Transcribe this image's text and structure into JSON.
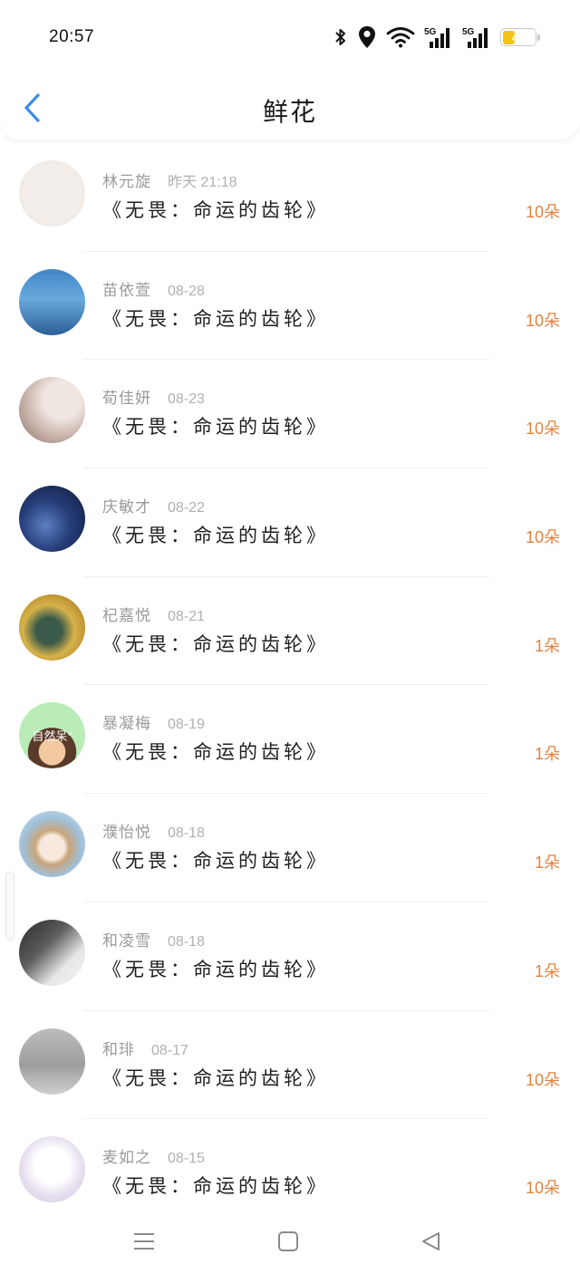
{
  "status_bar": {
    "time": "20:57",
    "battery_level": 43,
    "battery_label": "43",
    "icons": [
      "bluetooth-icon",
      "location-icon",
      "wifi-icon",
      "signal-5g-icon",
      "signal-5g-icon",
      "battery-icon"
    ],
    "network_label_1": "5G",
    "network_label_2": "5G"
  },
  "header": {
    "title": "鲜花",
    "back_icon": "chevron-left-icon",
    "accent_color": "#3a8ee6"
  },
  "colors": {
    "count_color": "#e3833f",
    "name_color": "#9a9a9a"
  },
  "items": [
    {
      "name": "林元旋",
      "time": "昨天 21:18",
      "book": "《无畏：命运的齿轮》",
      "count": "10朵",
      "avatar_label": ""
    },
    {
      "name": "苗依萱",
      "time": "08-28",
      "book": "《无畏：命运的齿轮》",
      "count": "10朵",
      "avatar_label": ""
    },
    {
      "name": "荀佳妍",
      "time": "08-23",
      "book": "《无畏：命运的齿轮》",
      "count": "10朵",
      "avatar_label": ""
    },
    {
      "name": "庆敏才",
      "time": "08-22",
      "book": "《无畏：命运的齿轮》",
      "count": "10朵",
      "avatar_label": ""
    },
    {
      "name": "杞嘉悦",
      "time": "08-21",
      "book": "《无畏：命运的齿轮》",
      "count": "1朵",
      "avatar_label": ""
    },
    {
      "name": "暴凝梅",
      "time": "08-19",
      "book": "《无畏：命运的齿轮》",
      "count": "1朵",
      "avatar_label": "自然呆°"
    },
    {
      "name": "濮怡悦",
      "time": "08-18",
      "book": "《无畏：命运的齿轮》",
      "count": "1朵",
      "avatar_label": ""
    },
    {
      "name": "和凌雪",
      "time": "08-18",
      "book": "《无畏：命运的齿轮》",
      "count": "1朵",
      "avatar_label": ""
    },
    {
      "name": "和琲",
      "time": "08-17",
      "book": "《无畏：命运的齿轮》",
      "count": "10朵",
      "avatar_label": ""
    },
    {
      "name": "麦如之",
      "time": "08-15",
      "book": "《无畏：命运的齿轮》",
      "count": "10朵",
      "avatar_label": ""
    }
  ],
  "bottom_nav": {
    "icons": [
      "menu-icon",
      "home-square-icon",
      "back-triangle-icon"
    ]
  }
}
